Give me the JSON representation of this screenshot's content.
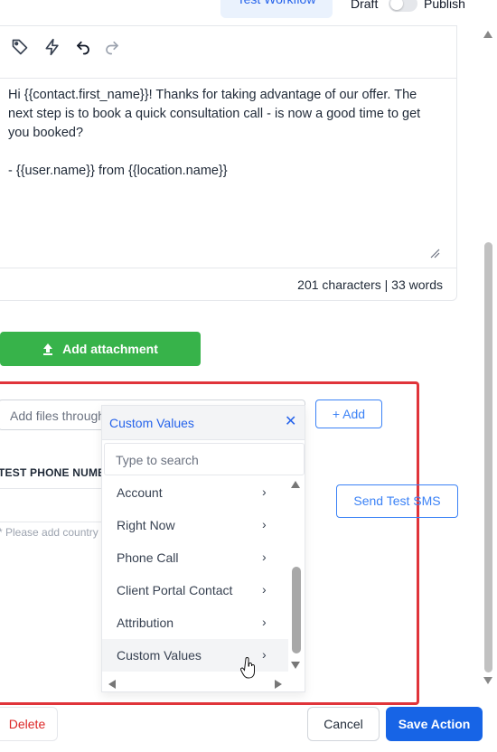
{
  "header": {
    "test_workflow_label": "Test Workflow",
    "draft_label": "Draft",
    "publish_label": "Publish"
  },
  "editor": {
    "toolbar_icons": [
      "tag-icon",
      "lightning-icon",
      "undo-icon",
      "redo-icon"
    ],
    "message": "Hi {{contact.first_name}}! Thanks for taking advantage of our offer. The next step is to book a quick consultation call - is now a good time to get you booked?\n\n- {{user.name}} from {{location.name}}",
    "counter": "201 characters | 33 words"
  },
  "attachment": {
    "button_label": "Add attachment"
  },
  "files": {
    "input_placeholder": "Add files through",
    "add_label": "+ Add"
  },
  "test_phone": {
    "label": "TEST PHONE NUMBER",
    "hint": "* Please add country",
    "send_label": "Send Test SMS"
  },
  "dropdown": {
    "title": "Custom Values",
    "close_glyph": "✕",
    "search_placeholder": "Type to search",
    "items": [
      {
        "label": "Account"
      },
      {
        "label": "Right Now"
      },
      {
        "label": "Phone Call"
      },
      {
        "label": "Client Portal Contact"
      },
      {
        "label": "Attribution"
      },
      {
        "label": "Custom Values"
      }
    ],
    "active_item": "Custom Values"
  },
  "footer": {
    "delete_label": "Delete",
    "cancel_label": "Cancel",
    "save_label": "Save Action"
  },
  "colors": {
    "primary": "#1764e6",
    "success": "#37b34a",
    "danger": "#e0343a"
  }
}
